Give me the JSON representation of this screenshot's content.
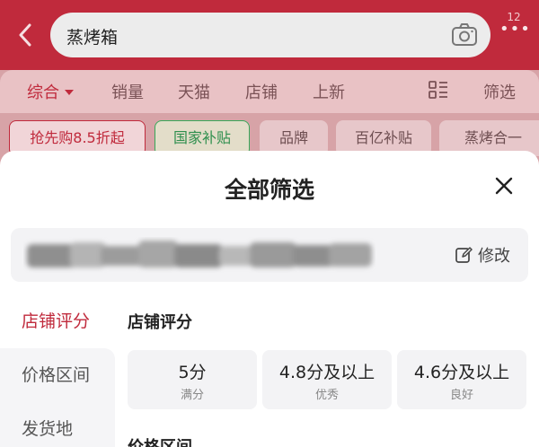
{
  "header": {
    "search_query": "蒸烤箱",
    "more_count": "12",
    "more_dots": "•••",
    "back_icon": "chevron-left-icon",
    "camera_icon": "camera-icon",
    "accent_color": "#c02a3c"
  },
  "sort_bar": {
    "items": [
      {
        "label": "综合",
        "active": true
      },
      {
        "label": "销量"
      },
      {
        "label": "天猫"
      },
      {
        "label": "店铺"
      },
      {
        "label": "上新"
      }
    ],
    "view_toggle_icon": "list-view-icon",
    "filter_label": "筛选"
  },
  "chips": [
    {
      "label": "抢先购8.5折起",
      "style": "promo"
    },
    {
      "label": "国家补贴",
      "style": "green"
    },
    {
      "label": "品牌"
    },
    {
      "label": "百亿补贴"
    },
    {
      "label": "蒸烤合一"
    }
  ],
  "sheet": {
    "title": "全部筛选",
    "close_icon": "close-icon",
    "edit_label": "修改",
    "edit_icon": "edit-icon",
    "nav": [
      {
        "label": "店铺评分",
        "active": true
      },
      {
        "label": "价格区间"
      },
      {
        "label": "发货地"
      }
    ],
    "sections": {
      "rating_title": "店铺评分",
      "price_title": "价格区间"
    },
    "rating_options": [
      {
        "value": "5分",
        "desc": "满分"
      },
      {
        "value": "4.8分及以上",
        "desc": "优秀"
      },
      {
        "value": "4.6分及以上",
        "desc": "良好"
      }
    ]
  }
}
